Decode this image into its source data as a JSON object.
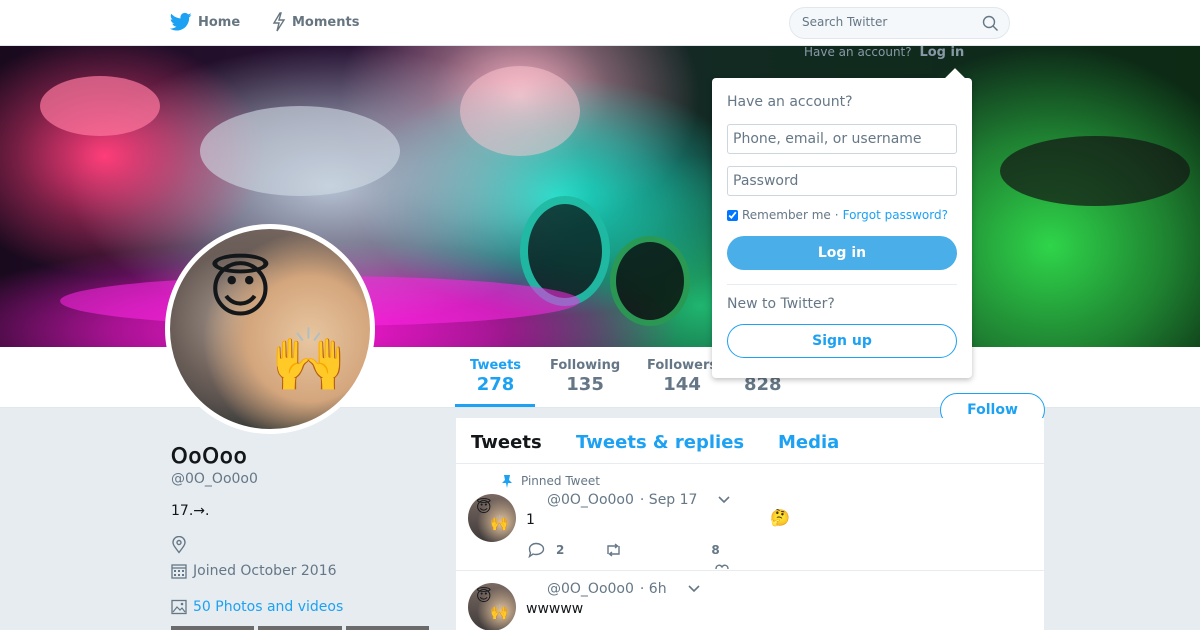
{
  "nav": {
    "home_label": "Home",
    "moments_label": "Moments",
    "search_placeholder": "Search Twitter",
    "login_prompt": "Have an account?",
    "login_link": "Log in"
  },
  "profile": {
    "name": "𝖮𝗈𝖮𝗈𝗈",
    "handle": "@0O_Oo0o0",
    "bio": "17.→.",
    "joined": "Joined October 2016",
    "photos_link": "50 Photos and videos"
  },
  "stats": [
    {
      "label": "Tweets",
      "value": "278"
    },
    {
      "label": "Following",
      "value": "135"
    },
    {
      "label": "Followers",
      "value": "144"
    },
    {
      "label": "",
      "value": "828"
    }
  ],
  "follow_label": "Follow",
  "tabs": [
    "Tweets",
    "Tweets & replies",
    "Media"
  ],
  "tweets": [
    {
      "pinned_label": "Pinned Tweet",
      "handle": "@0O_Oo0o0",
      "time": "· Sep 17",
      "text": "1",
      "emoji": "🤔",
      "replies": "2",
      "likes": "8"
    },
    {
      "handle": "@0O_Oo0o0",
      "time": "· 6h",
      "text": "wwwww"
    }
  ],
  "login": {
    "heading": "Have an account?",
    "username_placeholder": "Phone, email, or username",
    "password_placeholder": "Password",
    "remember_label": "Remember me",
    "separator": "·",
    "forgot_label": "Forgot password?",
    "login_button": "Log in",
    "new_heading": "New to Twitter?",
    "signup_button": "Sign up"
  },
  "colors": {
    "accent": "#1da1f2",
    "background": "#e6ecf0",
    "muted": "#657786"
  }
}
